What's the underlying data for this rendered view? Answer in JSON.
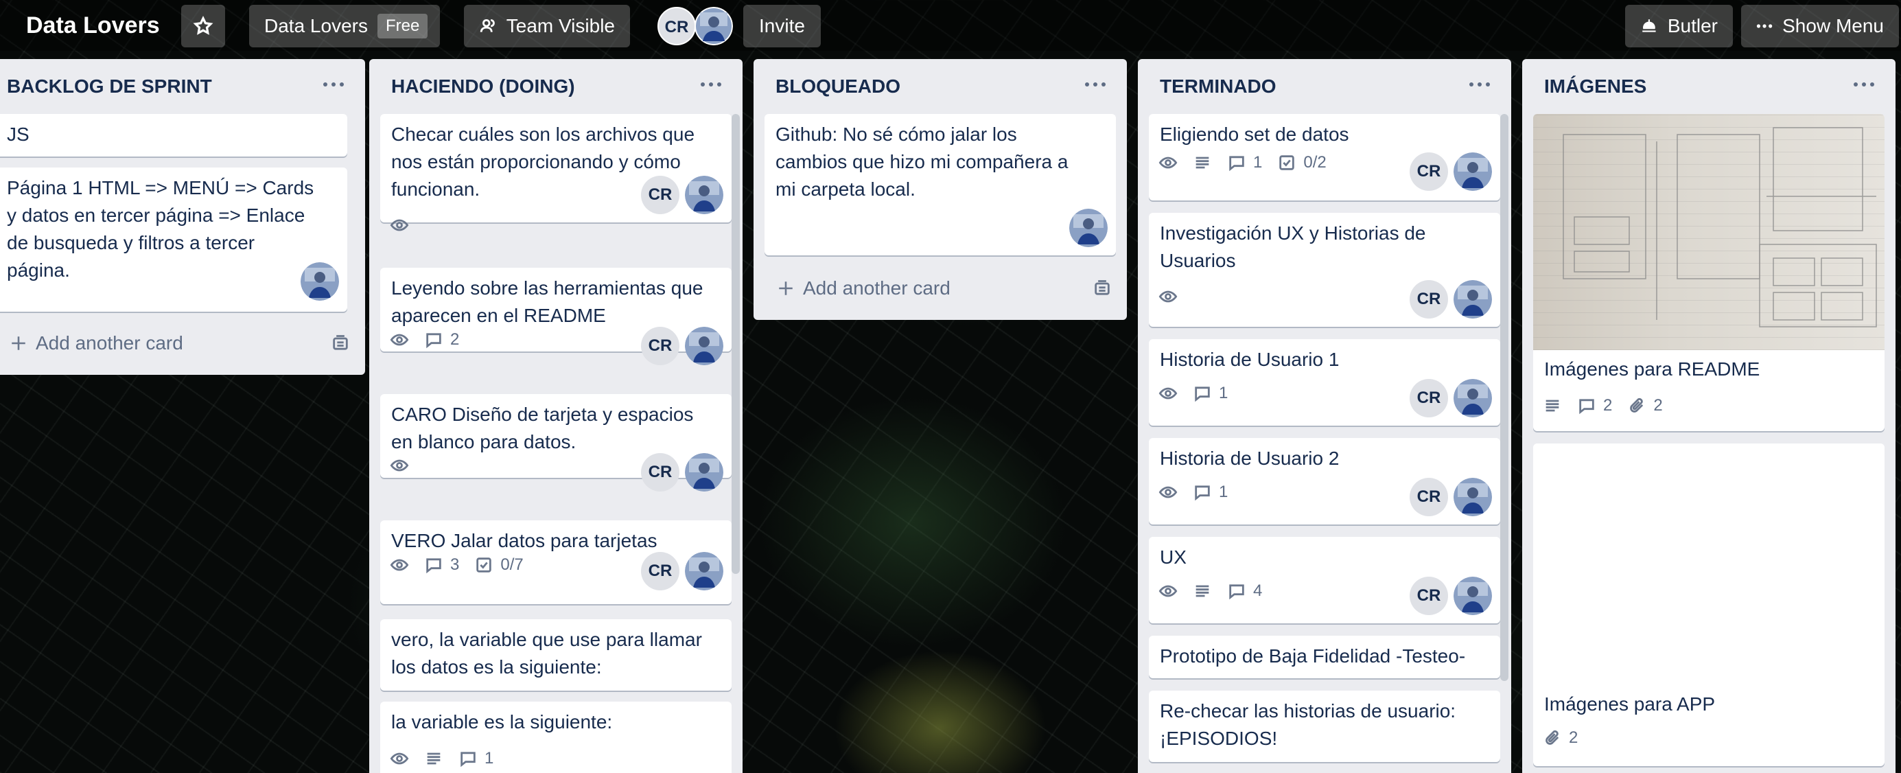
{
  "header": {
    "board_title": "Data Lovers",
    "org_name": "Data Lovers",
    "org_badge": "Free",
    "visibility": "Team Visible",
    "member_initials": "CR",
    "invite": "Invite",
    "butler": "Butler",
    "show_menu": "Show Menu"
  },
  "lists": [
    {
      "title": "BACKLOG DE SPRINT",
      "cards": [
        {
          "text": "JS"
        },
        {
          "text": "Página 1 HTML => MENÚ => Cards y datos en tercer página => Enlace de busqueda y filtros a tercer página."
        }
      ],
      "add_card": "Add another card"
    },
    {
      "title": "HACIENDO (DOING)",
      "cards": [
        {
          "text": "Checar cuáles son los archivos que nos están proporcionando y cómo funcionan.",
          "initials": "CR"
        },
        {
          "text": "Leyendo sobre las herramientas que aparecen en el README",
          "comments": "2",
          "initials": "CR"
        },
        {
          "text": "CARO Diseño de tarjeta y espacios en blanco para datos.",
          "initials": "CR"
        },
        {
          "text": "VERO Jalar datos para tarjetas",
          "comments": "3",
          "checklist": "0/7",
          "initials": "CR"
        },
        {
          "text": "vero, la variable que use para llamar los datos es la siguiente:"
        },
        {
          "text": "la variable es la siguiente:",
          "comments": "1"
        }
      ]
    },
    {
      "title": "BLOQUEADO",
      "cards": [
        {
          "text": "Github: No sé cómo jalar los cambios que hizo mi compañera a mi carpeta local."
        }
      ],
      "add_card": "Add another card"
    },
    {
      "title": "TERMINADO",
      "cards": [
        {
          "text": "Eligiendo set de datos",
          "comments": "1",
          "checklist": "0/2",
          "initials": "CR"
        },
        {
          "text": "Investigación UX y Historias de Usuarios",
          "initials": "CR"
        },
        {
          "text": "Historia de Usuario 1",
          "comments": "1",
          "initials": "CR"
        },
        {
          "text": "Historia de Usuario 2",
          "comments": "1",
          "initials": "CR"
        },
        {
          "text": "UX",
          "comments": "4",
          "initials": "CR"
        },
        {
          "text": "Prototipo de Baja Fidelidad -Testeo-"
        },
        {
          "text": "Re-checar las historias de usuario: ¡EPISODIOS!"
        }
      ]
    },
    {
      "title": "IMÁGENES",
      "cards": [
        {
          "text": "Imágenes para README",
          "comments": "2",
          "attachments": "2"
        },
        {
          "text": "Imágenes para APP",
          "attachments": "2"
        }
      ]
    }
  ],
  "colors": {
    "list_bg": "#ebecf0",
    "card_bg": "#ffffff",
    "text": "#172b4d",
    "muted": "#5e6c84"
  }
}
